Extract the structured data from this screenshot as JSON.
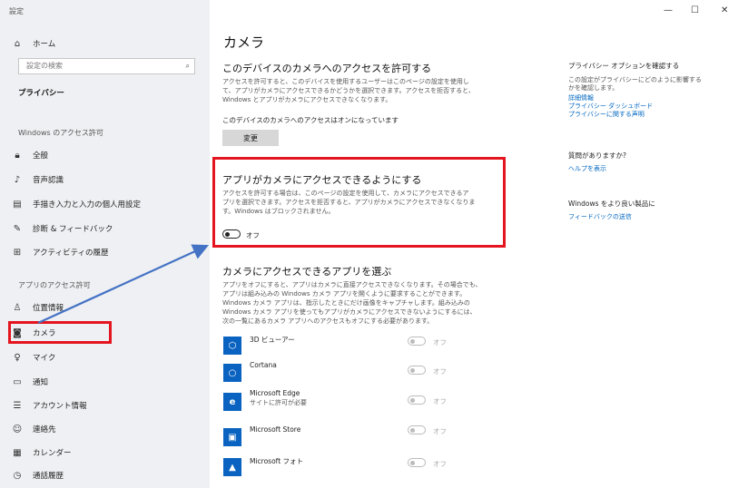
{
  "window": {
    "title": "設定",
    "minimize": "—",
    "maximize": "☐",
    "close": "✕"
  },
  "sidebar": {
    "home": "ホーム",
    "search_placeholder": "設定の検索",
    "section_title": "プライバシー",
    "group1": "Windows のアクセス許可",
    "group1_items": [
      {
        "label": "全般",
        "icon": "lock-icon"
      },
      {
        "label": "音声認識",
        "icon": "speech-icon"
      },
      {
        "label": "手描き入力と入力の個人用設定",
        "icon": "clipboard-icon"
      },
      {
        "label": "診断 & フィードバック",
        "icon": "feedback-icon"
      },
      {
        "label": "アクティビティの履歴",
        "icon": "timeline-icon"
      }
    ],
    "group2": "アプリのアクセス許可",
    "group2_items": [
      {
        "label": "位置情報",
        "icon": "location-icon"
      },
      {
        "label": "カメラ",
        "icon": "camera-icon"
      },
      {
        "label": "マイク",
        "icon": "microphone-icon"
      },
      {
        "label": "通知",
        "icon": "notification-icon"
      },
      {
        "label": "アカウント情報",
        "icon": "account-icon"
      },
      {
        "label": "連絡先",
        "icon": "contacts-icon"
      },
      {
        "label": "カレンダー",
        "icon": "calendar-icon"
      },
      {
        "label": "通話履歴",
        "icon": "history-icon"
      }
    ]
  },
  "main": {
    "title": "カメラ",
    "device_section": {
      "heading": "このデバイスのカメラへのアクセスを許可する",
      "description_lines": [
        "アクセスを許可すると、このデバイスを使用するユーザーはこのページの設定を使用し",
        "て、アプリがカメラにアクセスできるかどうかを選択できます。アクセスを拒否すると、",
        "Windows とアプリがカメラにアクセスできなくなります。"
      ],
      "status": "このデバイスのカメラへのアクセスはオンになっています",
      "change_button": "変更"
    },
    "apps_access": {
      "heading": "アプリがカメラにアクセスできるようにする",
      "description_lines": [
        "アクセスを許可する場合は、このページの設定を使用して、カメラにアクセスできるア",
        "プリを選択できます。アクセスを拒否すると、アプリがカメラにアクセスできなくなりま",
        "す。Windows はブロックされません。"
      ],
      "toggle_label": "オフ"
    },
    "choose_apps": {
      "heading": "カメラにアクセスできるアプリを選ぶ",
      "description_lines": [
        "アプリをオフにすると、アプリはカメラに直接アクセスできなくなります。その場合でも、",
        "アプリは組み込みの Windows カメラ アプリを開くように要求することができます。",
        "Windows カメラ アプリは、指示したときにだけ画像をキャプチャします。組み込みの",
        "Windows カメラ アプリを使ってもアプリがカメラにアクセスできないようにするには、",
        "次の一覧にあるカメラ アプリへのアクセスもオフにする必要があります。"
      ],
      "apps": [
        {
          "name": "3D ビューアー",
          "sub": "",
          "toggle": "オフ",
          "icon": "cube-icon"
        },
        {
          "name": "Cortana",
          "sub": "",
          "toggle": "オフ",
          "icon": "cortana-icon"
        },
        {
          "name": "Microsoft Edge",
          "sub": "サイトに許可が必要",
          "toggle": "オフ",
          "icon": "edge-icon"
        },
        {
          "name": "Microsoft Store",
          "sub": "",
          "toggle": "オフ",
          "icon": "store-icon"
        },
        {
          "name": "Microsoft フォト",
          "sub": "",
          "toggle": "オフ",
          "icon": "photos-icon"
        }
      ]
    }
  },
  "right": {
    "options_heading": "プライバシー オプションを確認する",
    "options_desc_lines": [
      "この設定がプライバシーにどのように影響する",
      "かを確認します。"
    ],
    "links": [
      "詳細情報",
      "プライバシー ダッシュボード",
      "プライバシーに関する声明"
    ],
    "question_heading": "質問がありますか?",
    "help_link": "ヘルプを表示",
    "improve_heading": "Windows をより良い製品に",
    "feedback_link": "フィードバックの送信"
  },
  "colors": {
    "highlight_border": "#e4151f",
    "arrow": "#4472c4",
    "app_icon": "#0a63c0",
    "link": "#0067c0"
  }
}
